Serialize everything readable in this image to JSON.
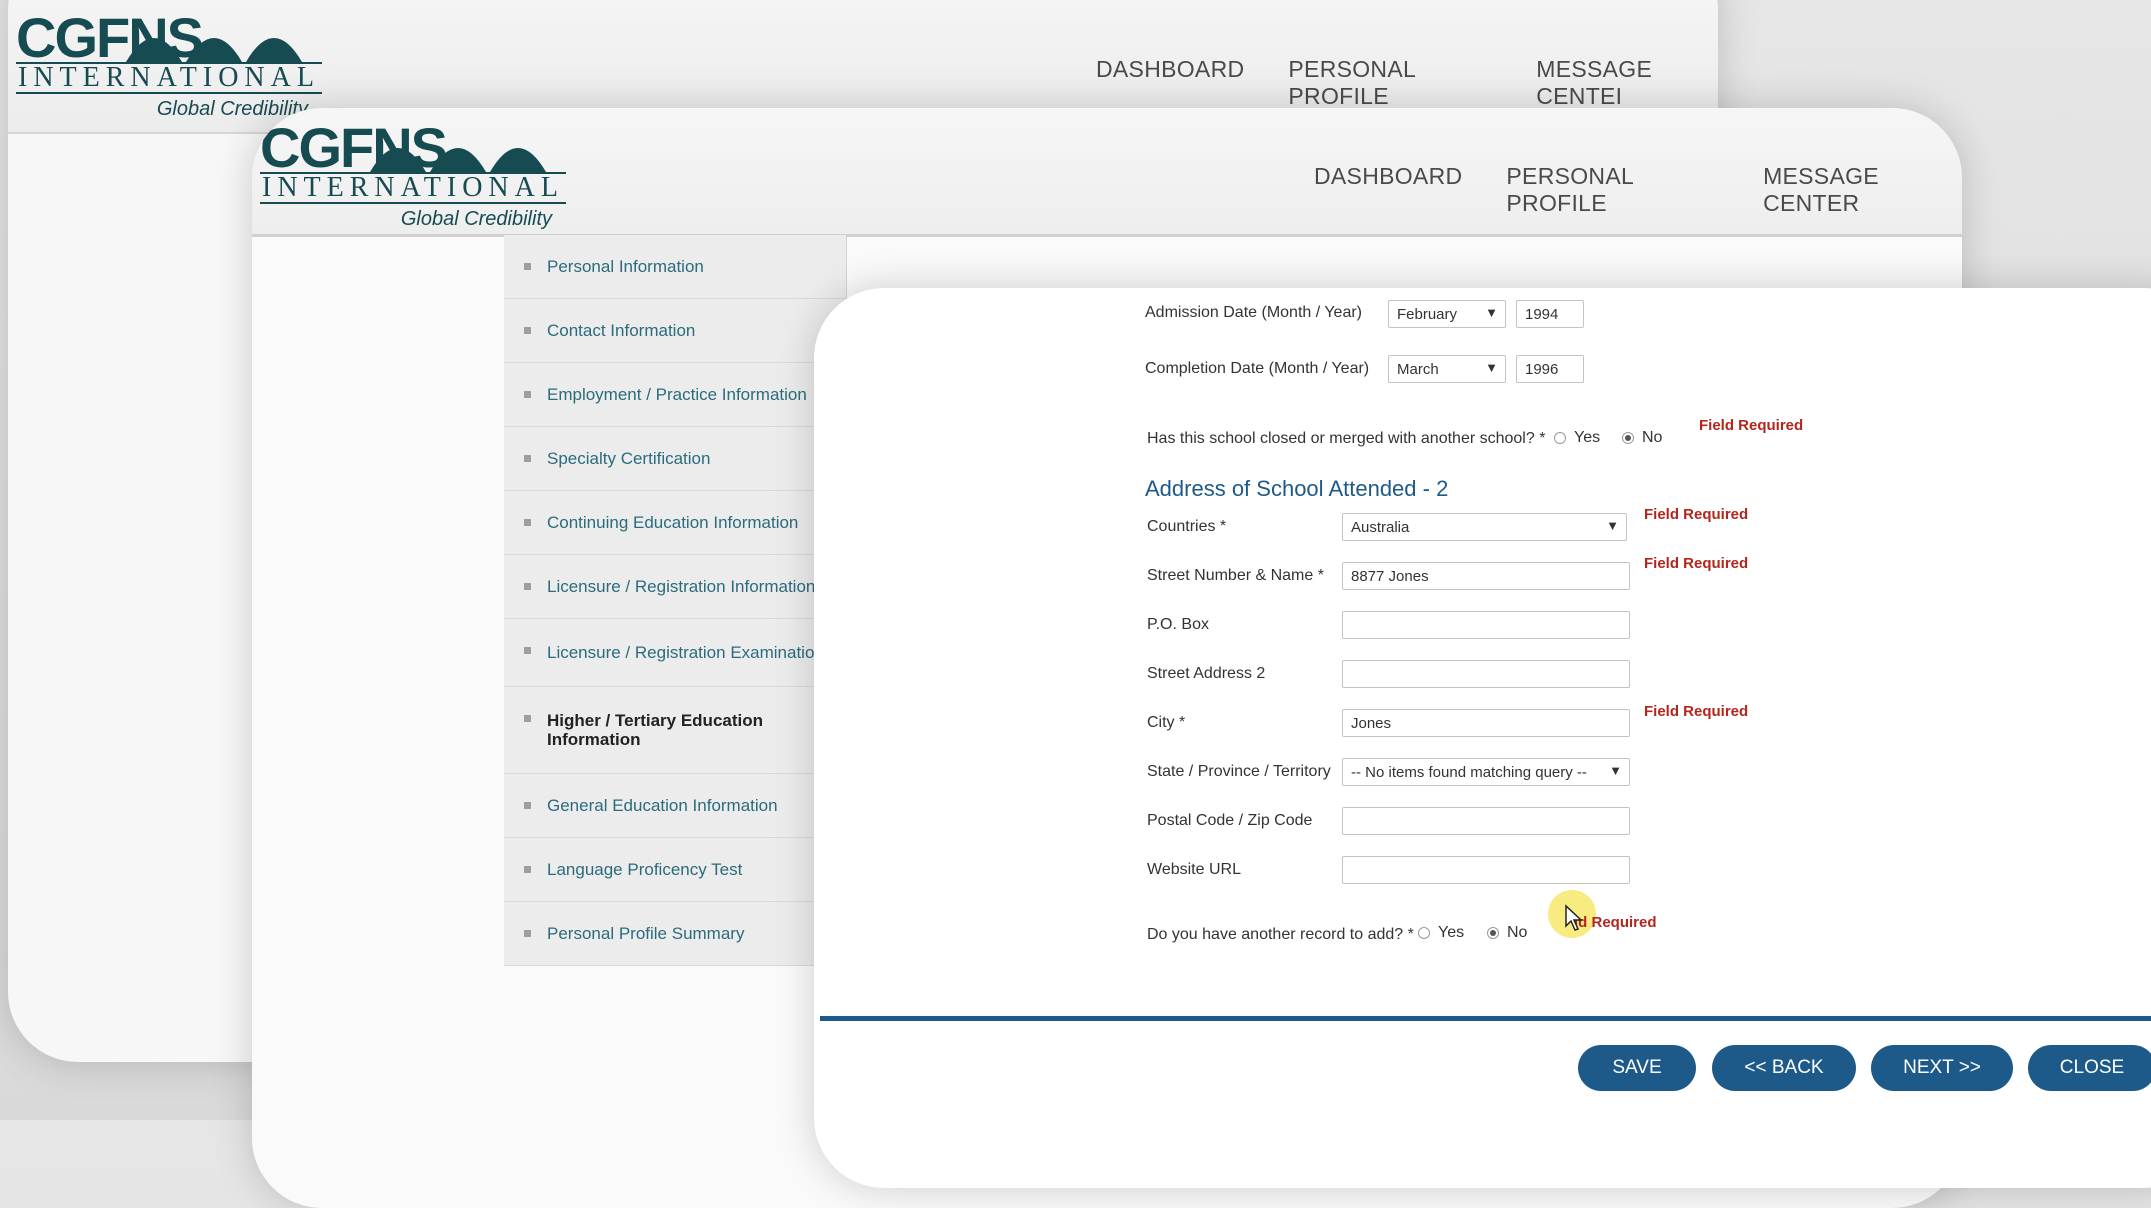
{
  "brand": {
    "name": "CGFNS",
    "international": "INTERNATIONAL",
    "tagline": "Global Credibility"
  },
  "nav": {
    "dashboard": "DASHBOARD",
    "personal_profile": "PERSONAL PROFILE",
    "message_center": "MESSAGE CENTER",
    "message_center_cut": "MESSAGE CENTEI"
  },
  "sidebar": {
    "items": [
      {
        "label": "Personal Information"
      },
      {
        "label": "Contact Information"
      },
      {
        "label": "Employment / Practice Information"
      },
      {
        "label": "Specialty Certification"
      },
      {
        "label": "Continuing Education Information"
      },
      {
        "label": "Licensure / Registration Information"
      },
      {
        "label": "Licensure / Registration Examinations"
      },
      {
        "label": "Higher / Tertiary Education Information"
      },
      {
        "label": "General Education Information"
      },
      {
        "label": "Language Proficency Test"
      },
      {
        "label": "Personal Profile Summary"
      }
    ],
    "active_index": 7
  },
  "form": {
    "admission_label": "Admission Date (Month / Year)",
    "admission_month": "February",
    "admission_year": "1994",
    "completion_label": "Completion Date (Month / Year)",
    "completion_month": "March",
    "completion_year": "1996",
    "closed_question": "Has this school closed or merged with another school? *",
    "yes": "Yes",
    "no": "No",
    "field_required": "Field Required",
    "section_title": "Address of School Attended - 2",
    "countries_label": "Countries *",
    "countries_value": "Australia",
    "street_label": "Street Number & Name *",
    "street_value": "8877 Jones",
    "pobox_label": "P.O. Box",
    "pobox_value": "",
    "street2_label": "Street Address 2",
    "street2_value": "",
    "city_label": "City *",
    "city_value": "Jones",
    "state_label": "State / Province / Territory",
    "state_value": "-- No items found matching query --",
    "postal_label": "Postal Code / Zip Code",
    "postal_value": "",
    "website_label": "Website URL",
    "website_value": "",
    "another_question": "Do you have another record to add? *",
    "field_required_partial": "ld Required"
  },
  "buttons": {
    "save": "SAVE",
    "back": "<< BACK",
    "next": "NEXT >>",
    "close": "CLOSE"
  },
  "colors": {
    "accent": "#1d5a8a",
    "brand": "#174b52",
    "required": "#b3261e",
    "link": "#2a6b7e"
  }
}
